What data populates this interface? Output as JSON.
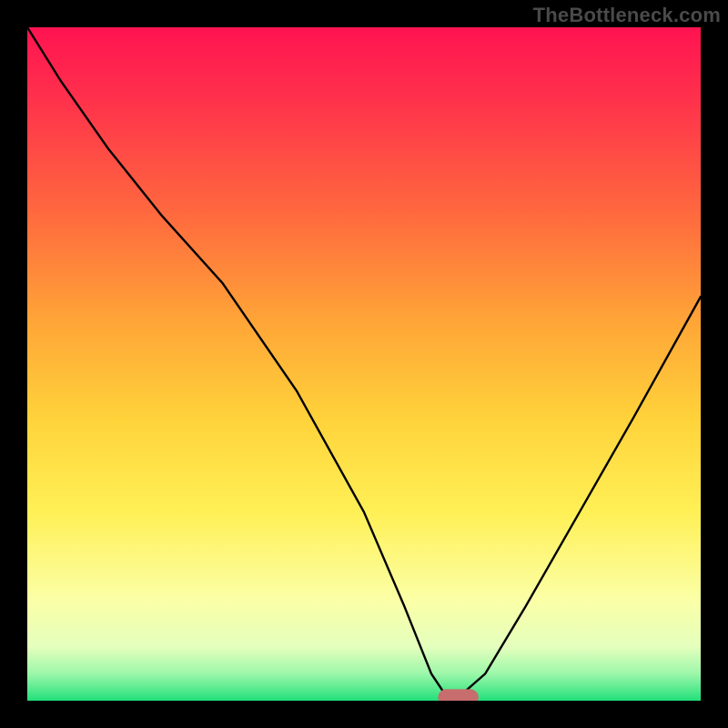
{
  "caption": "TheBottleneck.com",
  "colors": {
    "curve_stroke": "#000000",
    "marker_fill": "#c86d6d",
    "frame_bg": "#000000"
  },
  "chart_data": {
    "type": "line",
    "title": "",
    "xlabel": "",
    "ylabel": "",
    "xlim": [
      0,
      100
    ],
    "ylim": [
      0,
      100
    ],
    "grid": false,
    "legend": false,
    "series": [
      {
        "name": "bottleneck-curve",
        "x": [
          0,
          5,
          12,
          20,
          29,
          40,
          50,
          56,
          60,
          62,
          64,
          68,
          74,
          82,
          90,
          100
        ],
        "values": [
          100,
          92,
          82,
          72,
          62,
          46,
          28,
          14,
          4,
          1,
          0.5,
          4,
          14,
          28,
          42,
          60
        ]
      }
    ],
    "marker": {
      "name": "optimal-point",
      "x": 64,
      "y": 0.5,
      "rx": 3.0,
      "ry": 1.2
    },
    "background_gradient": {
      "stops": [
        {
          "pos": 0,
          "color": "#ff1351"
        },
        {
          "pos": 10,
          "color": "#ff2f4c"
        },
        {
          "pos": 28,
          "color": "#ff6a3e"
        },
        {
          "pos": 44,
          "color": "#ffa637"
        },
        {
          "pos": 58,
          "color": "#ffd23a"
        },
        {
          "pos": 72,
          "color": "#fff056"
        },
        {
          "pos": 85,
          "color": "#fbffa6"
        },
        {
          "pos": 92,
          "color": "#e4ffbd"
        },
        {
          "pos": 96,
          "color": "#9cf7aa"
        },
        {
          "pos": 100,
          "color": "#22e07a"
        }
      ]
    }
  }
}
